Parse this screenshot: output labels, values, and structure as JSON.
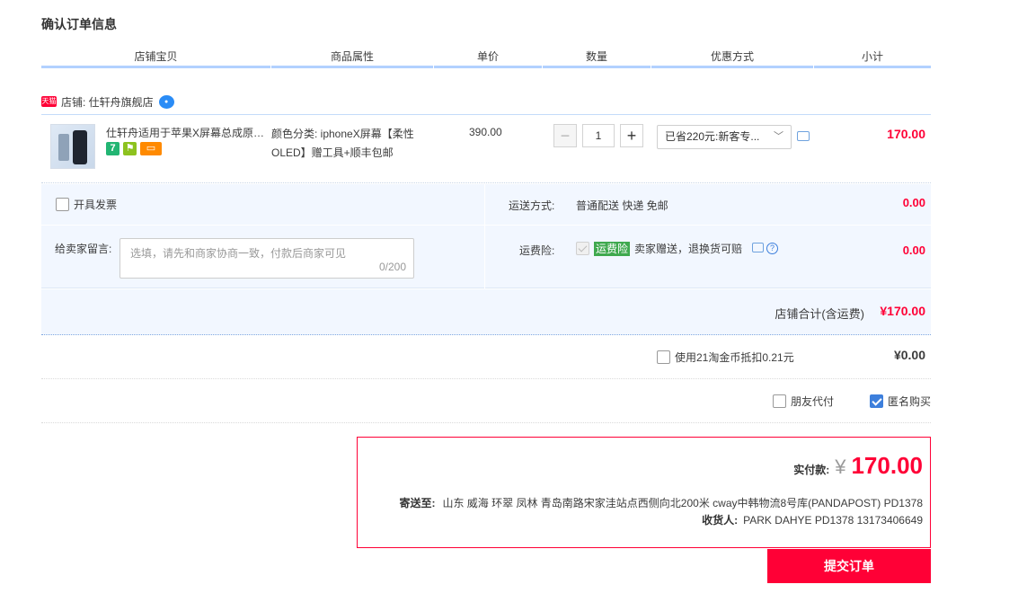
{
  "page_title": "确认订单信息",
  "columns": [
    "店铺宝贝",
    "商品属性",
    "单价",
    "数量",
    "优惠方式",
    "小计"
  ],
  "shop": {
    "badge": "天猫",
    "name": "店铺: 仕轩舟旗舰店"
  },
  "item": {
    "title": "仕轩舟适用于苹果X屏幕总成原装iphoneX屏幕",
    "attributes": "颜色分类: iphoneX屏幕【柔性OLED】赠工具+顺丰包邮",
    "unit_price": "390.00",
    "quantity": "1",
    "minus": "−",
    "plus": "+",
    "discount": "已省220元:新客专...",
    "subtotal": "170.00",
    "service_icons": [
      "seven-day-return-icon",
      "warranty-icon",
      "card-payment-icon"
    ],
    "service_seven": "7"
  },
  "invoice_label": "开具发票",
  "message": {
    "label": "给卖家留言:",
    "placeholder": "选填，请先和商家协商一致，付款后商家可见",
    "counter": "0/200"
  },
  "shipping": {
    "label": "运送方式:",
    "value": "普通配送 快递 免邮",
    "fee": "0.00"
  },
  "insurance": {
    "label": "运费险:",
    "tag": "运费险",
    "text": "卖家赠送，退换货可赔",
    "fee": "0.00",
    "help": "?"
  },
  "shop_total": {
    "label": "店铺合计(含运费)",
    "amount": "¥170.00"
  },
  "coin": {
    "label": "使用21淘金币抵扣0.21元",
    "amount": "¥0.00"
  },
  "friend_pay": "朋友代付",
  "anonymous": "匿名购买",
  "summary": {
    "paid_label": "实付款:",
    "currency": "¥",
    "paid_amount": "170.00",
    "address_label": "寄送至:",
    "address": "山东 威海 环翠 凤林 青岛南路宋家洼站点西侧向北200米 cway中韩物流8号库(PANDAPOST) PD1378",
    "receiver_label": "收货人:",
    "receiver": "PARK DAHYE PD1378 13173406649"
  },
  "submit_label": "提交订单",
  "colors": {
    "accent": "#ff0036",
    "header_line": "#b2d1ff",
    "panel": "#f2f7ff",
    "check": "#3d7fdc"
  }
}
